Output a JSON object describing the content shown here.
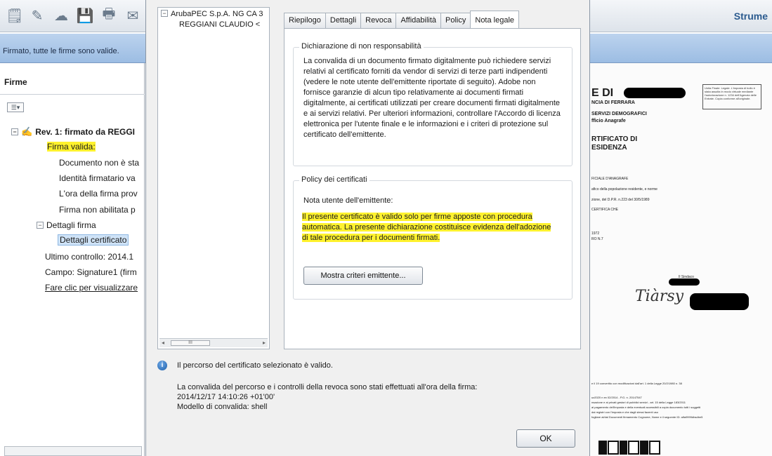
{
  "toolbar": {
    "right_label": "Strume",
    "icons": [
      "notes-icon",
      "edit-icon",
      "cloud-icon",
      "save-icon",
      "print-icon",
      "mail-icon"
    ]
  },
  "signature_bar": {
    "message": "Firmato, tutte le firme sono valide."
  },
  "signatures_panel": {
    "title": "Firme",
    "options_label": "☰▾",
    "tree": {
      "root": "Rev. 1: firmato da REGGI",
      "valid": "Firma valida:",
      "items": [
        "Documento non è sta",
        "Identità firmatario va",
        "L'ora della firma prov",
        "Firma non abilitata p"
      ],
      "details_group": "Dettagli firma",
      "cert_details": "Dettagli certificato",
      "last_check": "Ultimo controllo: 2014.1",
      "field": "Campo: Signature1 (firm",
      "click_link": "Fare clic per visualizzare"
    }
  },
  "dialog": {
    "cert_tree": {
      "root": "ArubaPEC S.p.A. NG CA 3",
      "child": "REGGIANI CLAUDIO <",
      "scroll_thumb": "III"
    },
    "tabs": [
      "Riepilogo",
      "Dettagli",
      "Revoca",
      "Affidabilità",
      "Policy",
      "Nota legale"
    ],
    "active_tab": "Nota legale",
    "disclaimer": {
      "title": "Dichiarazione di non responsabilità",
      "text": "La convalida di un documento firmato digitalmente può richiedere servizi relativi al certificato forniti da vendor di servizi di terze parti indipendenti (vedere le note utente dell'emittente riportate di seguito). Adobe non fornisce garanzie di alcun tipo relativamente ai documenti firmati digitalmente, ai certificati utilizzati per creare documenti firmati digitalmente e ai servizi relativi. Per ulteriori informazioni, controllare l'Accordo di licenza elettronica per l'utente finale e le informazioni e i criteri di protezione sul certificato dell'emittente."
    },
    "policy": {
      "title": "Policy dei certificati",
      "note_label": "Nota utente dell'emittente:",
      "note_text": "Il presente certificato è valido solo per firme apposte con procedura automatica. La presente dichiarazione costituisce evidenza dell'adozione di tale procedura per i documenti firmati.",
      "button": "Mostra criteri emittente..."
    },
    "status": {
      "main": "Il percorso del certificato selezionato è valido.",
      "detail_1": "La convalida del percorso e i controlli della revoca sono stati effettuati all'ora della firma:",
      "detail_2": "2014/12/17 14:10:26 +01'00'",
      "detail_3": "Modello di convalida: shell"
    },
    "ok_label": "OK"
  },
  "document": {
    "heading": "E DI",
    "line_1": "NCIA DI FERRARA",
    "line_2": "SERVIZI DEMOGRAFICI",
    "line_3": "fficio Anagrafe",
    "cert_1": "RTIFICATO DI",
    "cert_2": "ESIDENZA",
    "body_1": "FICIALE D'ANAGRAFE",
    "body_2": "afico della popolazione residente, e norme",
    "body_3": "zione, del D.P.R. n.223 del 30/5/1989",
    "body_4": "CERTIFICA CHE",
    "body_5": "1972",
    "body_6": "RO N.7",
    "signer_label": "Il Sindaco",
    "signature": "Tiàrsy",
    "footer_1": "e il 19 convertito con modificazioni dall'art. 1 della Legge 20/2/1980 n. 38",
    "footer_2": "uz2020 n ex 02/2014 - P.G. n. 20147547",
    "footer_3": "nsazione e ai privati gestori di pubblici servizi - art. 15 della Legge 183/2011",
    "footer_4": "ai pagamento dell'imposta e della eventuali accessibili a copia documento tutti i soggetti",
    "footer_5": "dai registri con l'imposta e che dagli stessi facenti uso",
    "footer_6": "fogliare al/dal Documenti firmamento Cognome, Nome e il seguente ID: alfa9999dbsdbe5",
    "stamp_text": "Unita Finale: Legale. L'imposta di bollo è stata assolta in modo virtuale mediante l'autorizzazione n. 1234 dell'Agenzia delle Entrate. Copia conforme all'originale."
  }
}
